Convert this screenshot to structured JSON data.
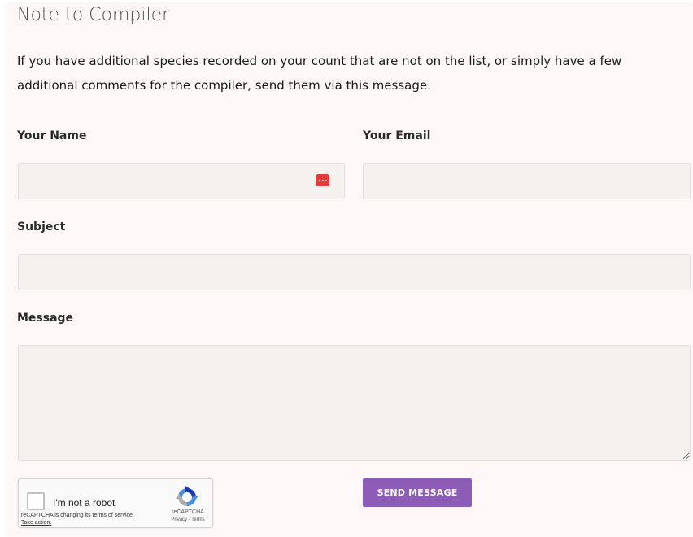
{
  "form": {
    "title": "Note to Compiler",
    "intro": "If you have additional species recorded on your count that are not on the list, or simply have a few additional comments for the compiler, send them via this message.",
    "name_label": "Your Name",
    "name_value": "",
    "email_label": "Your Email",
    "email_value": "",
    "subject_label": "Subject",
    "subject_value": "",
    "message_label": "Message",
    "message_value": "",
    "send_label": "SEND MESSAGE"
  },
  "recaptcha": {
    "checkbox_label": "I'm not a robot",
    "notice": "reCAPTCHA is changing its terms of service.",
    "notice_link": "Take action.",
    "brand": "reCAPTCHA",
    "privacy": "Privacy",
    "separator": " - ",
    "terms": "Terms"
  },
  "colors": {
    "panel_background": "#fdf8f7",
    "field_background": "#f4f1ef",
    "button": "#8c5cb6",
    "password_manager_icon": "#e03c3c"
  },
  "icons": {
    "name_field_icon": "password-manager-icon",
    "recaptcha_logo": "recaptcha-logo-icon"
  }
}
